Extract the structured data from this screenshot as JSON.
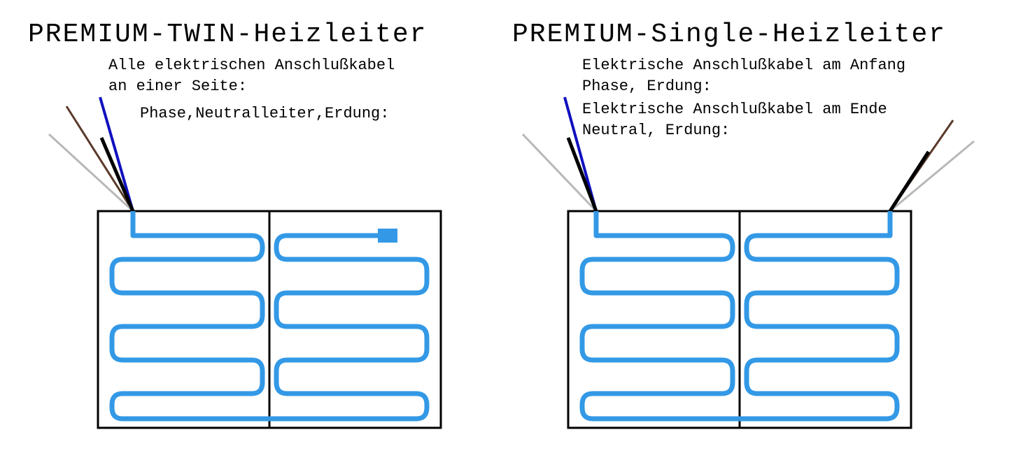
{
  "left": {
    "title": "PREMIUM-TWIN-Heizleiter",
    "line1": "Alle elektrischen Anschlußkabel",
    "line2": "an einer Seite:",
    "line3": "Phase,Neutralleiter,Erdung:"
  },
  "right": {
    "title": "PREMIUM-Single-Heizleiter",
    "line1": "Elektrische Anschlußkabel am Anfang",
    "line2": "Phase, Erdung:",
    "line3": "Elektrische Anschlußkabel am Ende",
    "line4": "Neutral, Erdung:"
  },
  "colors": {
    "cable": "#3399e6",
    "box": "#000000",
    "wire_brown": "#5a3a2a",
    "wire_blue": "#1010c0",
    "wire_grey": "#b8b8b8"
  }
}
